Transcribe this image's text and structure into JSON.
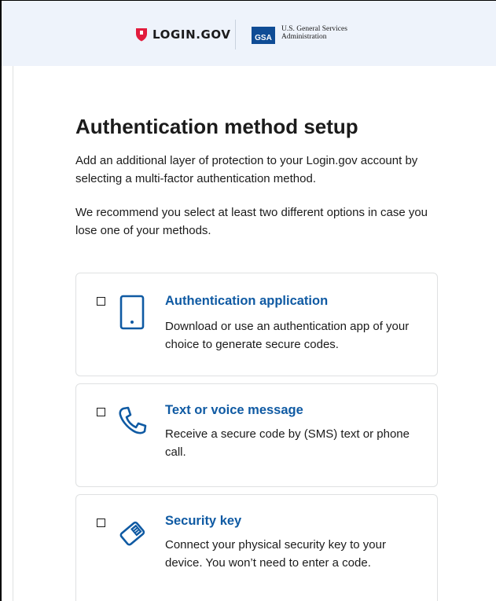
{
  "header": {
    "logo_text": "LOGIN.GOV",
    "gsa_badge": "GSA",
    "gsa_line1": "U.S. General Services",
    "gsa_line2": "Administration"
  },
  "main": {
    "title": "Authentication method setup",
    "intro_1": "Add an additional layer of protection to your Login.gov account by selecting a multi-factor authentication method.",
    "intro_2": "We recommend you select at least two different options in case you lose one of your methods."
  },
  "options": [
    {
      "icon": "phone-icon",
      "title": "Authentication application",
      "description": "Download or use an authentication app of your choice to generate secure codes.",
      "checked": false
    },
    {
      "icon": "telephone-handset-icon",
      "title": "Text or voice message",
      "description": "Receive a secure code by (SMS) text or phone call.",
      "checked": false
    },
    {
      "icon": "security-key-icon",
      "title": "Security key",
      "description": "Connect your physical security key to your device. You won’t need to enter a code.",
      "checked": false
    }
  ],
  "colors": {
    "header_bg": "#eef3fb",
    "accent_blue": "#0f5aa3",
    "logo_red": "#e21c3d",
    "gsa_blue": "#0f4c95",
    "border": "#dfe1e2"
  }
}
